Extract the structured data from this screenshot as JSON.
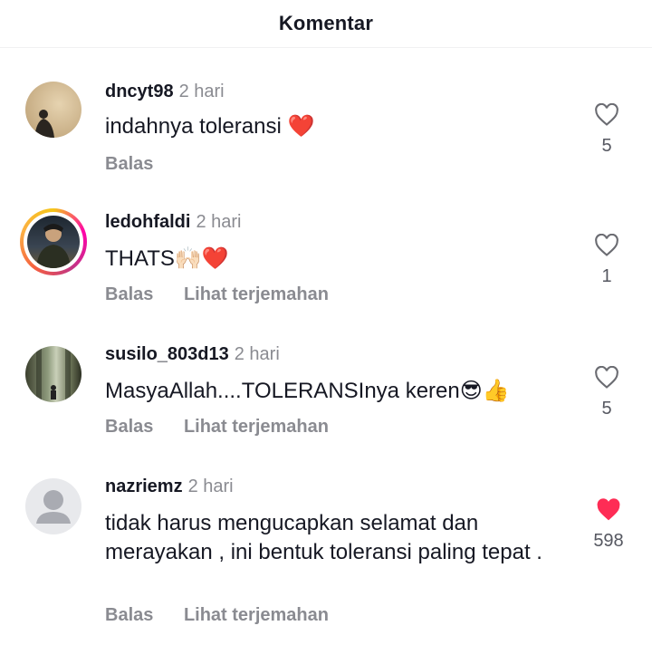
{
  "header": {
    "title": "Komentar"
  },
  "comments": [
    {
      "username": "dncyt98",
      "time": "2 hari",
      "text": "indahnya toleransi",
      "emoji": "❤️",
      "reply_label": "Balas",
      "translate_label": "",
      "likes": "5",
      "liked": false
    },
    {
      "username": "ledohfaldi",
      "time": "2 hari",
      "text": "THATS",
      "emoji": "🙌🏻❤️",
      "reply_label": "Balas",
      "translate_label": "Lihat terjemahan",
      "likes": "1",
      "liked": false
    },
    {
      "username": "susilo_803d13",
      "time": "2 hari",
      "text": "MasyaAllah....TOLERANSInya keren",
      "emoji": "😎👍",
      "reply_label": "Balas",
      "translate_label": "Lihat terjemahan",
      "likes": "5",
      "liked": false
    },
    {
      "username": "nazriemz",
      "time": "2 hari",
      "text": "tidak harus mengucapkan selamat dan merayakan , ini bentuk toleransi paling tepat .",
      "emoji": "",
      "reply_label": "Balas",
      "translate_label": "Lihat terjemahan",
      "likes": "598",
      "liked": true
    }
  ],
  "colors": {
    "liked_heart": "#fe2c55",
    "muted": "#8a8b91"
  }
}
